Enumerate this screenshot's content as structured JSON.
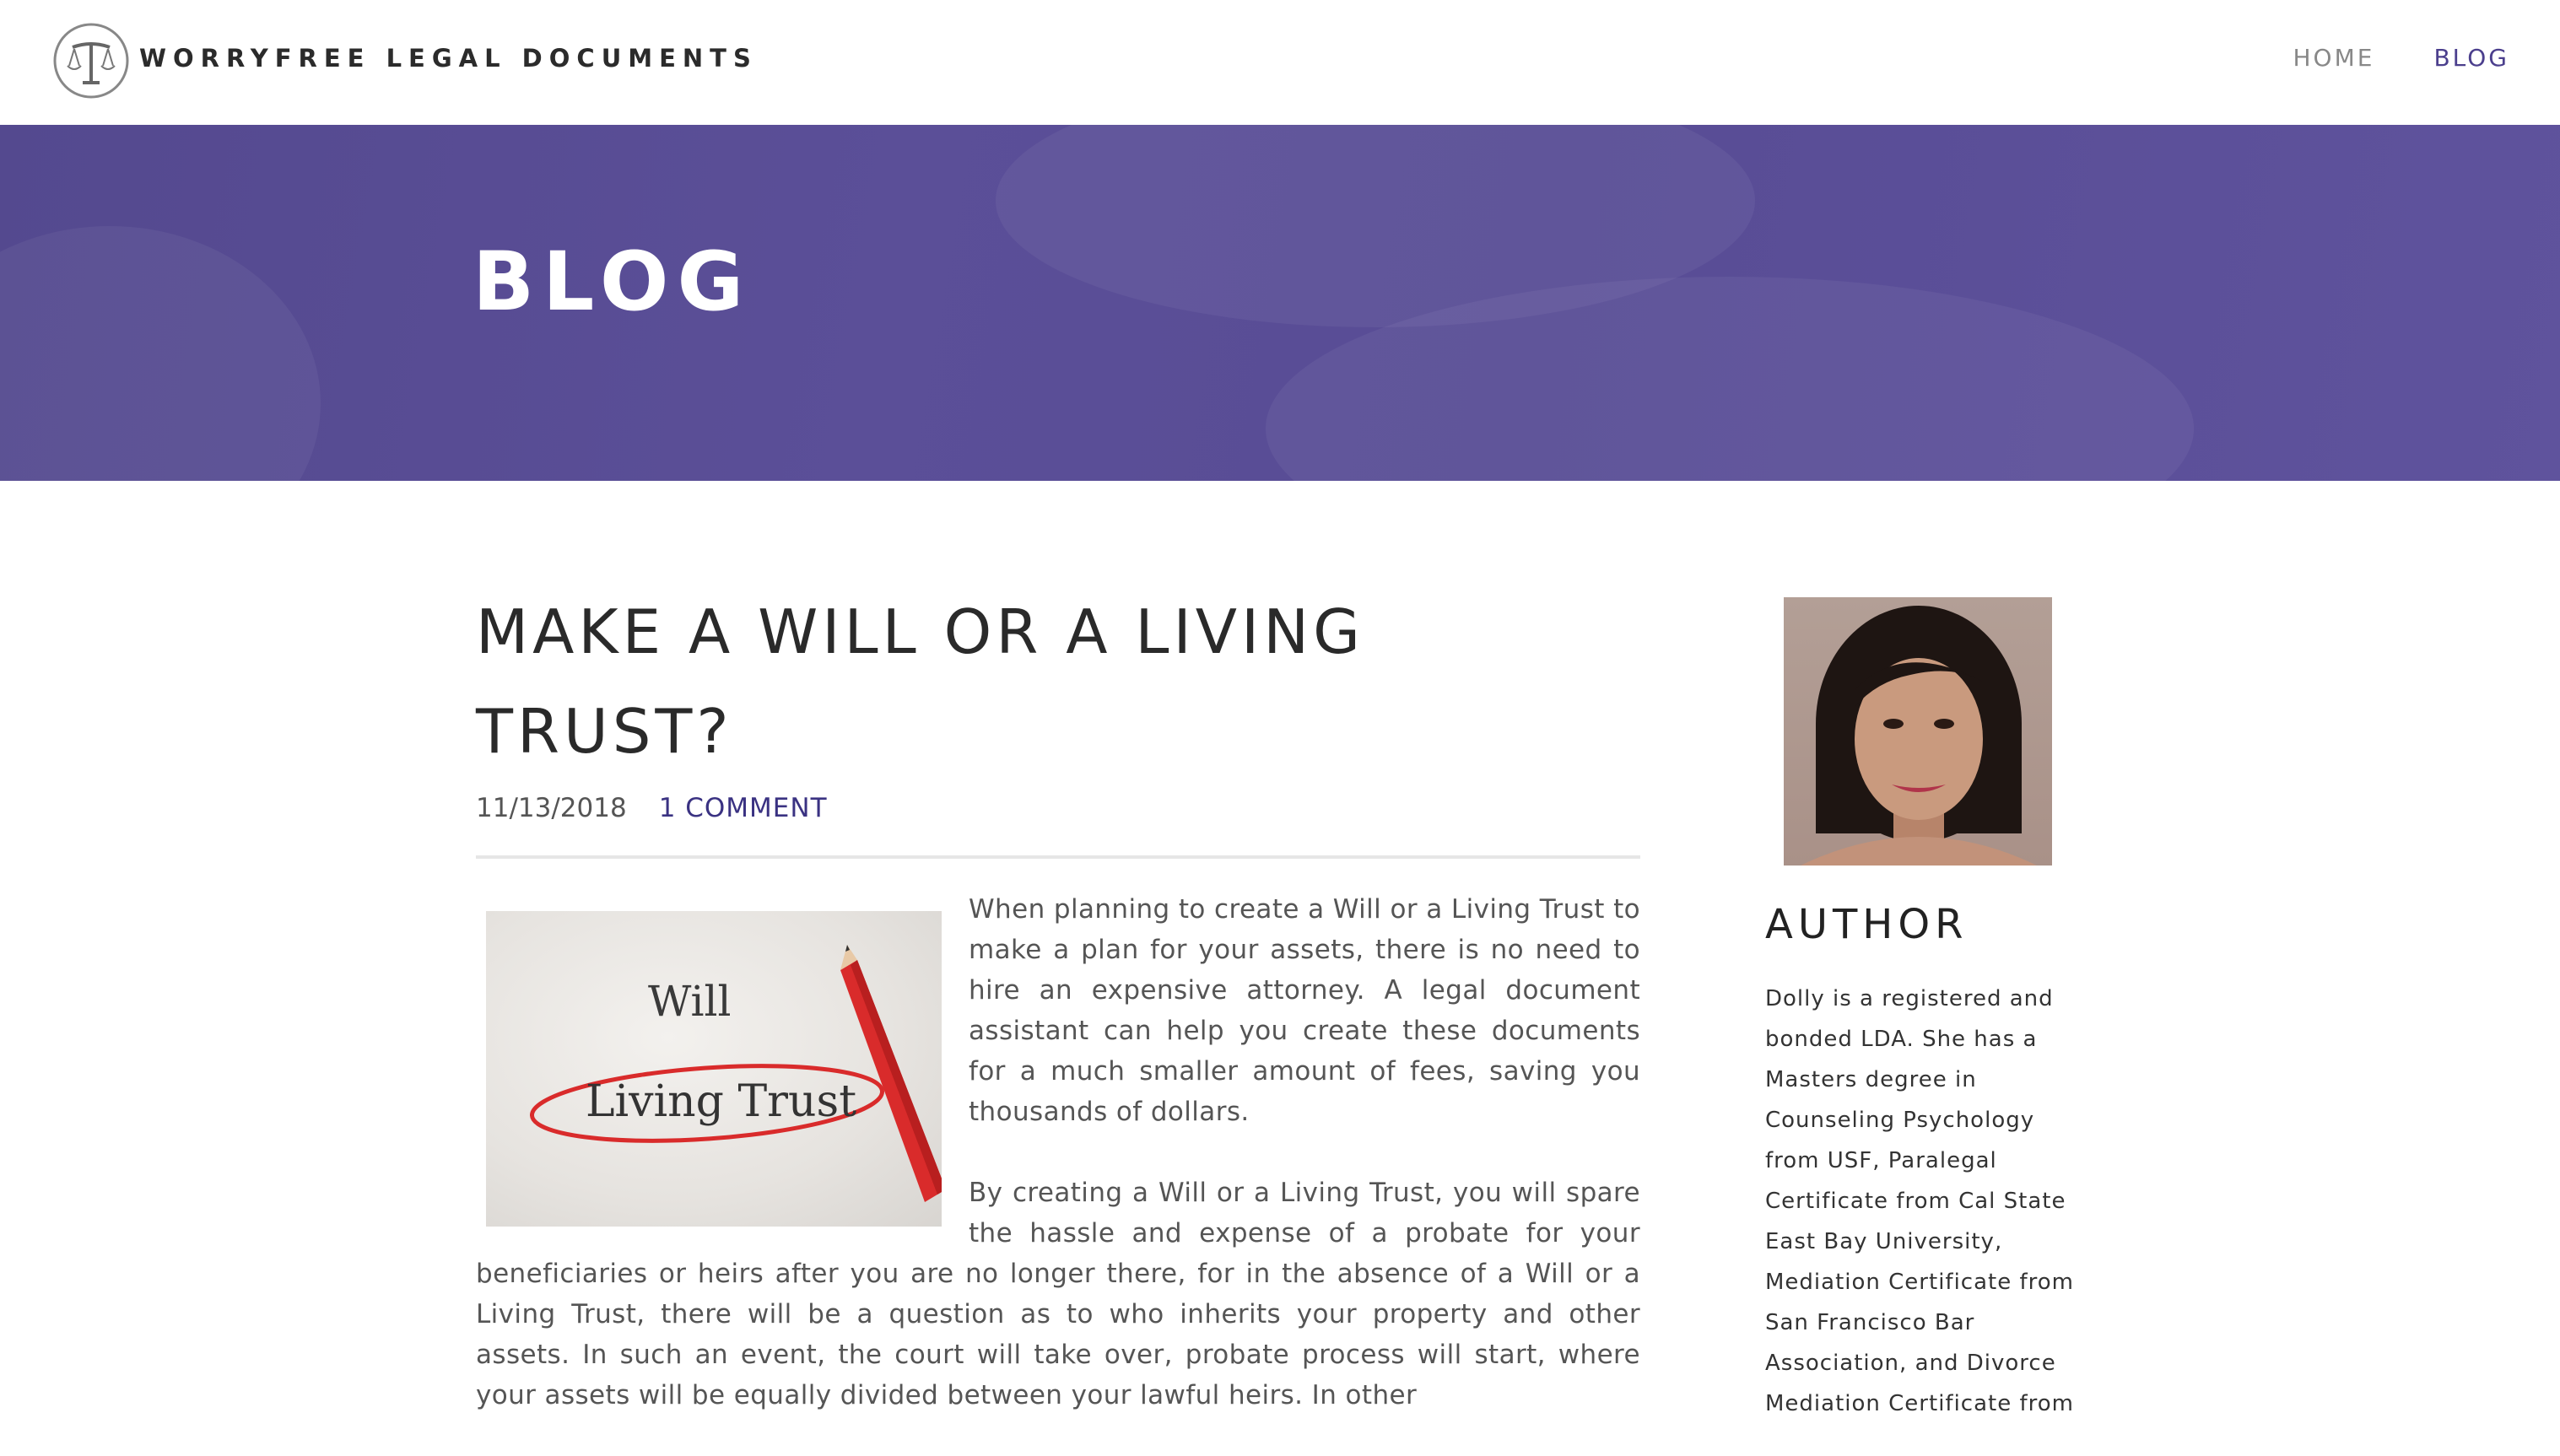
{
  "header": {
    "brand": "WORRYFREE LEGAL DOCUMENTS",
    "nav": [
      {
        "label": "HOME",
        "active": false
      },
      {
        "label": "BLOG",
        "active": true
      }
    ],
    "logo_icon": "scales-of-justice-icon"
  },
  "banner": {
    "title": "BLOG"
  },
  "post": {
    "title": "MAKE A WILL OR A LIVING TRUST?",
    "date": "11/13/2018",
    "comments": "1 COMMENT",
    "image": {
      "word_top": "Will",
      "word_circled": "Living Trust"
    },
    "paragraphs": [
      "When planning to create a Will or a Living Trust to make a plan for your assets, there is no need to hire an expensive attorney. A legal document assistant can help you create these documents for a much smaller amount of fees, saving you thousands of dollars.",
      "By creating a Will or a Living Trust, you will spare the hassle and expense of a probate for your beneficiaries or heirs after you are no longer there, for in the absence of a Will or a Living Trust, there will be a question as to who inherits your property and other assets. In such an event, the court will take over, probate process will start, where your assets will be equally divided between your lawful heirs. In other"
    ]
  },
  "sidebar": {
    "heading": "AUTHOR",
    "bio": "Dolly is a registered and bonded LDA. She has a Masters degree in Counseling Psychology from USF, Paralegal Certificate from Cal State East Bay University, Mediation Certificate from San Francisco Bar Association, and Divorce Mediation Certificate from"
  },
  "colors": {
    "accent": "#4b3f8d",
    "banner": "#584c95",
    "pencil": "#d92b2b"
  }
}
